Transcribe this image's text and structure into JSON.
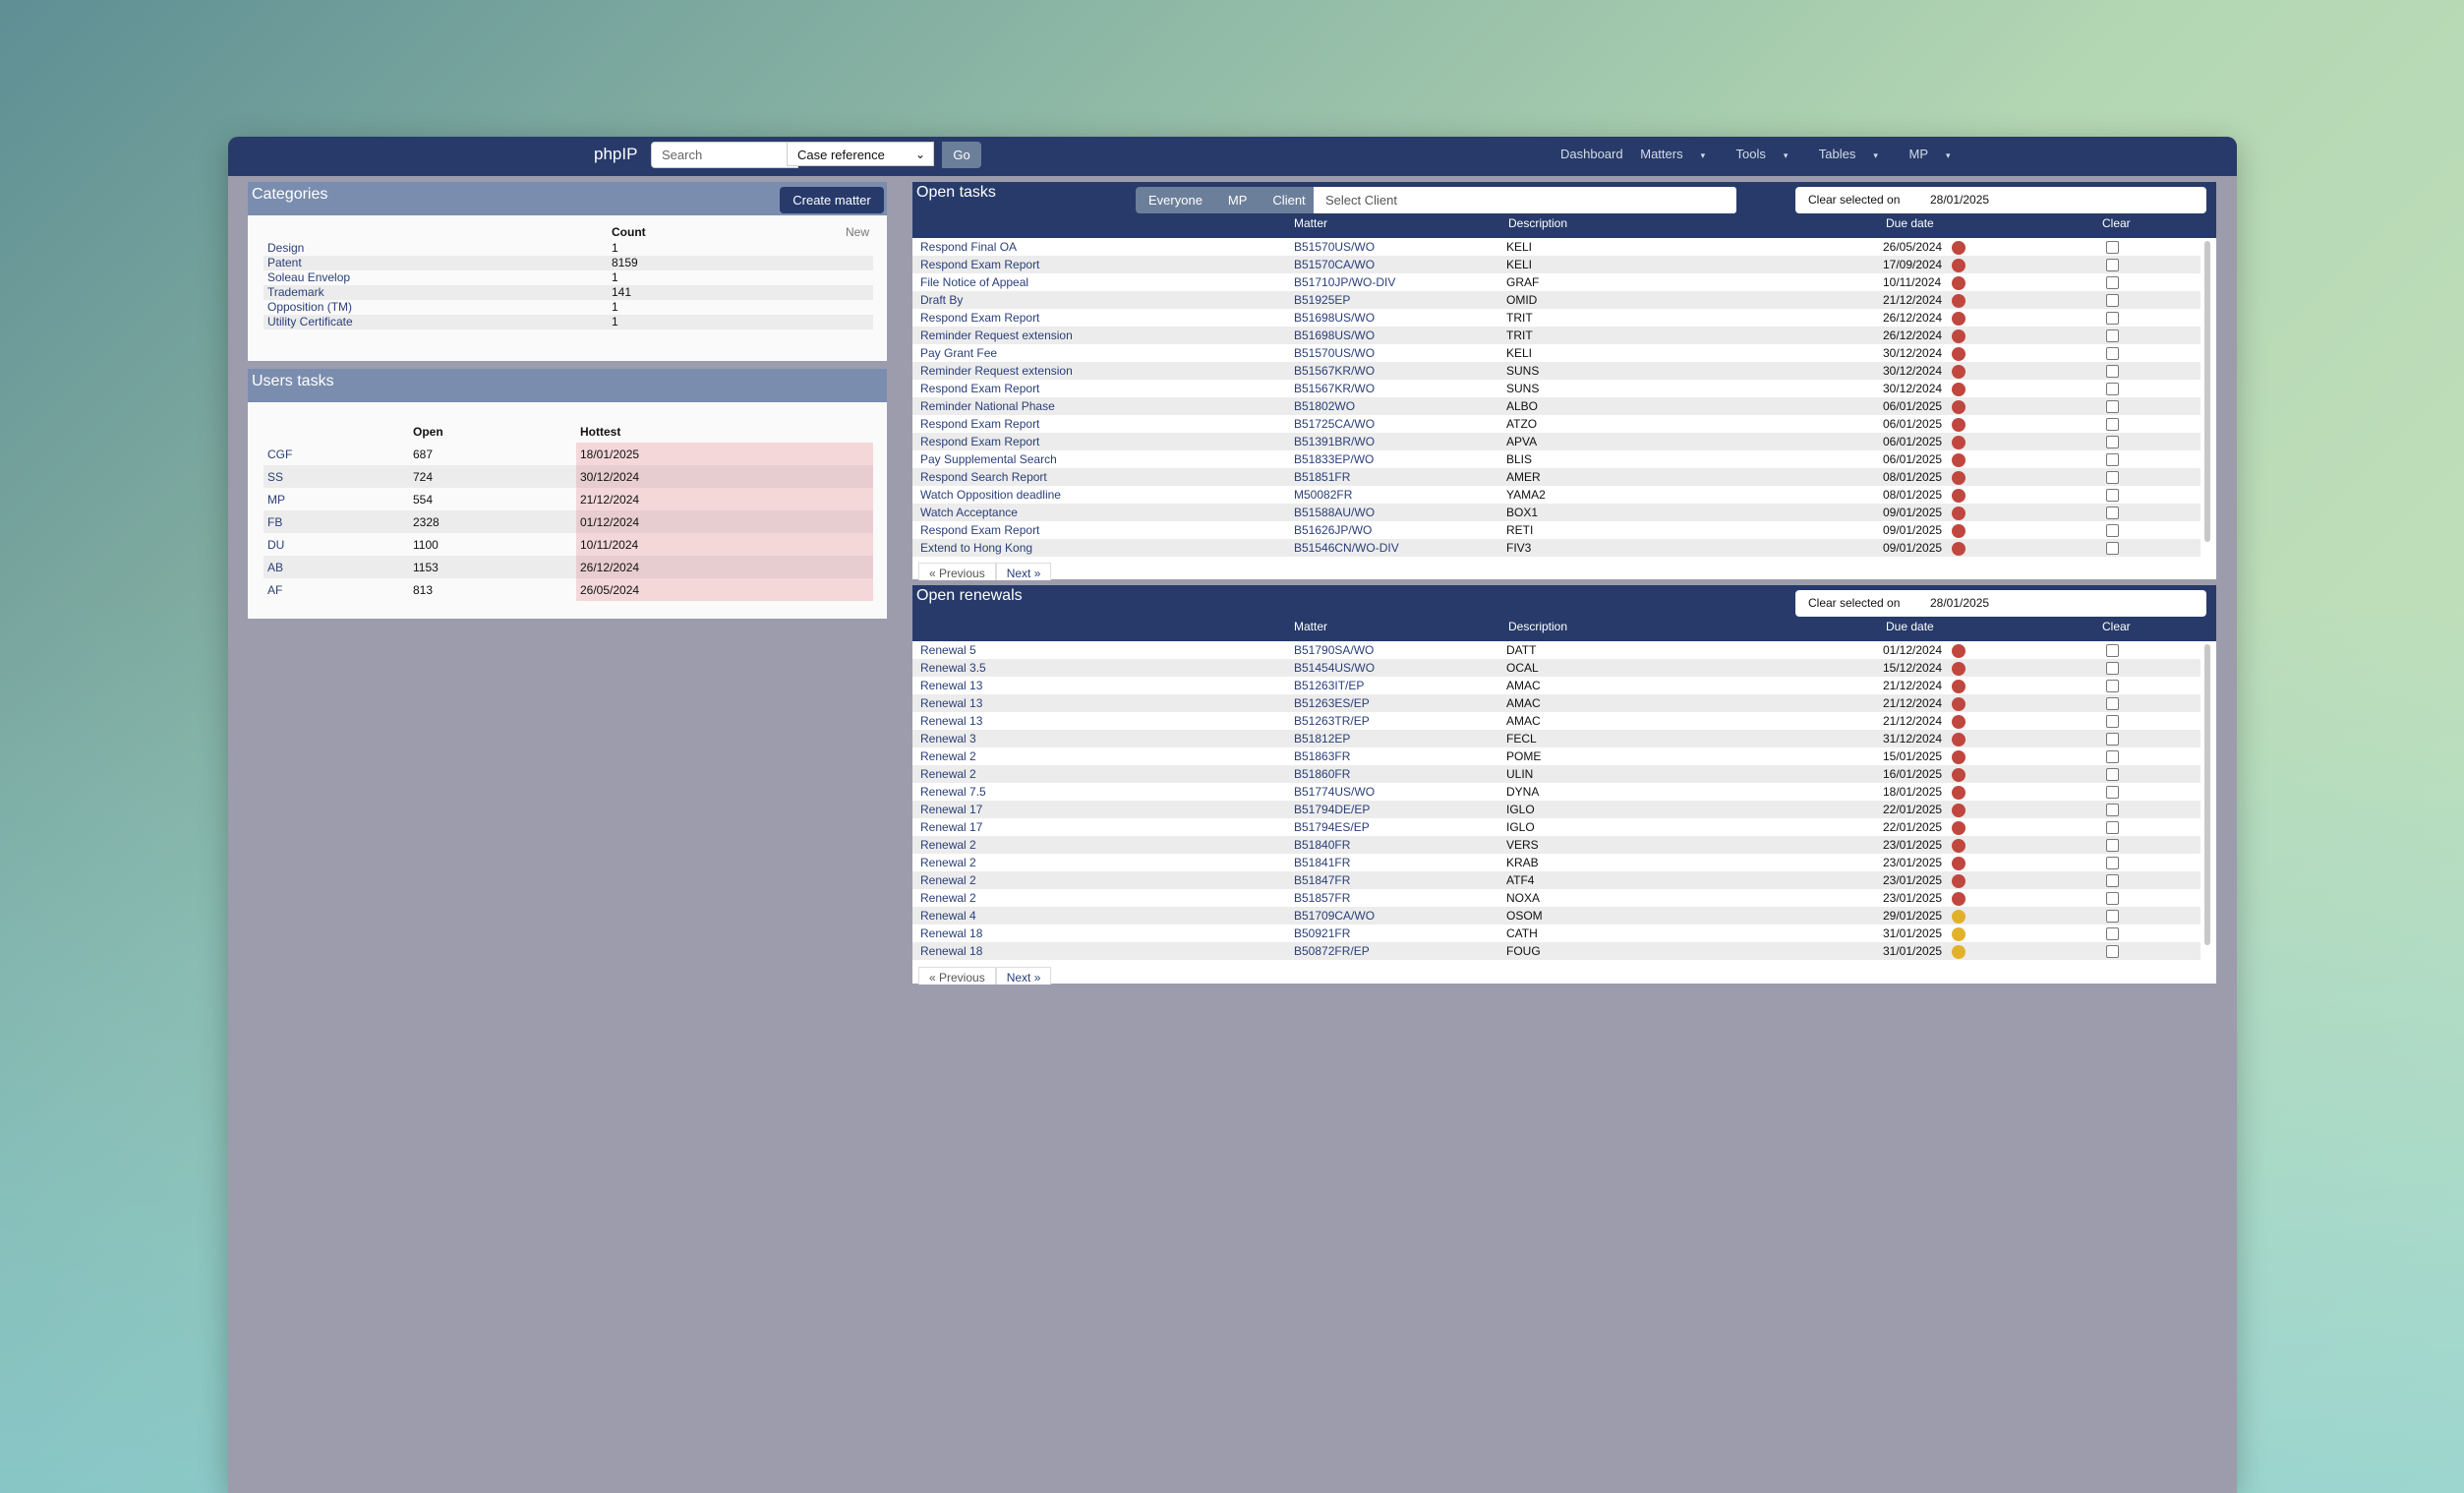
{
  "nav": {
    "brand": "phpIP",
    "search_placeholder": "Search",
    "search_type": "Case reference",
    "go": "Go",
    "menu": [
      "Dashboard",
      "Matters",
      "Tools",
      "Tables",
      "MP"
    ]
  },
  "categories": {
    "title": "Categories",
    "create_button": "Create matter",
    "col_count": "Count",
    "col_new": "New",
    "rows": [
      {
        "name": "Design",
        "count": "1"
      },
      {
        "name": "Patent",
        "count": "8159"
      },
      {
        "name": "Soleau Envelop",
        "count": "1"
      },
      {
        "name": "Trademark",
        "count": "141"
      },
      {
        "name": "Opposition (TM)",
        "count": "1"
      },
      {
        "name": "Utility Certificate",
        "count": "1"
      }
    ]
  },
  "users_tasks": {
    "title": "Users tasks",
    "col_open": "Open",
    "col_hottest": "Hottest",
    "rows": [
      {
        "user": "CGF",
        "open": "687",
        "hottest": "18/01/2025"
      },
      {
        "user": "SS",
        "open": "724",
        "hottest": "30/12/2024"
      },
      {
        "user": "MP",
        "open": "554",
        "hottest": "21/12/2024"
      },
      {
        "user": "FB",
        "open": "2328",
        "hottest": "01/12/2024"
      },
      {
        "user": "DU",
        "open": "1100",
        "hottest": "10/11/2024"
      },
      {
        "user": "AB",
        "open": "1153",
        "hottest": "26/12/2024"
      },
      {
        "user": "AF",
        "open": "813",
        "hottest": "26/05/2024"
      }
    ]
  },
  "open_tasks": {
    "title": "Open tasks",
    "filters": [
      "Everyone",
      "MP",
      "Client"
    ],
    "client_placeholder": "Select Client",
    "clear_label": "Clear selected on",
    "clear_date": "28/01/2025",
    "columns": {
      "matter": "Matter",
      "description": "Description",
      "due": "Due date",
      "clear": "Clear"
    },
    "prev": "« Previous",
    "next": "Next »",
    "rows": [
      {
        "task": "Respond Final OA",
        "matter": "B51570US/WO",
        "desc": "KELI",
        "due": "26/05/2024",
        "status": "red"
      },
      {
        "task": "Respond Exam Report",
        "matter": "B51570CA/WO",
        "desc": "KELI",
        "due": "17/09/2024",
        "status": "red"
      },
      {
        "task": "File Notice of Appeal",
        "matter": "B51710JP/WO-DIV",
        "desc": "GRAF",
        "due": "10/11/2024",
        "status": "red"
      },
      {
        "task": "Draft By",
        "matter": "B51925EP",
        "desc": "OMID",
        "due": "21/12/2024",
        "status": "red"
      },
      {
        "task": "Respond Exam Report",
        "matter": "B51698US/WO",
        "desc": "TRIT",
        "due": "26/12/2024",
        "status": "red"
      },
      {
        "task": "Reminder Request extension",
        "matter": "B51698US/WO",
        "desc": "TRIT",
        "due": "26/12/2024",
        "status": "red"
      },
      {
        "task": "Pay Grant Fee",
        "matter": "B51570US/WO",
        "desc": "KELI",
        "due": "30/12/2024",
        "status": "red"
      },
      {
        "task": "Reminder Request extension",
        "matter": "B51567KR/WO",
        "desc": "SUNS",
        "due": "30/12/2024",
        "status": "red"
      },
      {
        "task": "Respond Exam Report",
        "matter": "B51567KR/WO",
        "desc": "SUNS",
        "due": "30/12/2024",
        "status": "red"
      },
      {
        "task": "Reminder National Phase",
        "matter": "B51802WO",
        "desc": "ALBO",
        "due": "06/01/2025",
        "status": "red"
      },
      {
        "task": "Respond Exam Report",
        "matter": "B51725CA/WO",
        "desc": "ATZO",
        "due": "06/01/2025",
        "status": "red"
      },
      {
        "task": "Respond Exam Report",
        "matter": "B51391BR/WO",
        "desc": "APVA",
        "due": "06/01/2025",
        "status": "red"
      },
      {
        "task": "Pay Supplemental Search",
        "matter": "B51833EP/WO",
        "desc": "BLIS",
        "due": "06/01/2025",
        "status": "red"
      },
      {
        "task": "Respond Search Report",
        "matter": "B51851FR",
        "desc": "AMER",
        "due": "08/01/2025",
        "status": "red"
      },
      {
        "task": "Watch Opposition deadline",
        "matter": "M50082FR",
        "desc": "YAMA2",
        "due": "08/01/2025",
        "status": "red"
      },
      {
        "task": "Watch Acceptance",
        "matter": "B51588AU/WO",
        "desc": "BOX1",
        "due": "09/01/2025",
        "status": "red"
      },
      {
        "task": "Respond Exam Report",
        "matter": "B51626JP/WO",
        "desc": "RETI",
        "due": "09/01/2025",
        "status": "red"
      },
      {
        "task": "Extend to Hong Kong",
        "matter": "B51546CN/WO-DIV",
        "desc": "FIV3",
        "due": "09/01/2025",
        "status": "red"
      }
    ]
  },
  "open_renewals": {
    "title": "Open renewals",
    "clear_label": "Clear selected on",
    "clear_date": "28/01/2025",
    "columns": {
      "matter": "Matter",
      "description": "Description",
      "due": "Due date",
      "clear": "Clear"
    },
    "prev": "« Previous",
    "next": "Next »",
    "rows": [
      {
        "task": "Renewal 5",
        "matter": "B51790SA/WO",
        "desc": "DATT",
        "due": "01/12/2024",
        "status": "red"
      },
      {
        "task": "Renewal 3.5",
        "matter": "B51454US/WO",
        "desc": "OCAL",
        "due": "15/12/2024",
        "status": "red"
      },
      {
        "task": "Renewal 13",
        "matter": "B51263IT/EP",
        "desc": "AMAC",
        "due": "21/12/2024",
        "status": "red"
      },
      {
        "task": "Renewal 13",
        "matter": "B51263ES/EP",
        "desc": "AMAC",
        "due": "21/12/2024",
        "status": "red"
      },
      {
        "task": "Renewal 13",
        "matter": "B51263TR/EP",
        "desc": "AMAC",
        "due": "21/12/2024",
        "status": "red"
      },
      {
        "task": "Renewal 3",
        "matter": "B51812EP",
        "desc": "FECL",
        "due": "31/12/2024",
        "status": "red"
      },
      {
        "task": "Renewal 2",
        "matter": "B51863FR",
        "desc": "POME",
        "due": "15/01/2025",
        "status": "red"
      },
      {
        "task": "Renewal 2",
        "matter": "B51860FR",
        "desc": "ULIN",
        "due": "16/01/2025",
        "status": "red"
      },
      {
        "task": "Renewal 7.5",
        "matter": "B51774US/WO",
        "desc": "DYNA",
        "due": "18/01/2025",
        "status": "red"
      },
      {
        "task": "Renewal 17",
        "matter": "B51794DE/EP",
        "desc": "IGLO",
        "due": "22/01/2025",
        "status": "red"
      },
      {
        "task": "Renewal 17",
        "matter": "B51794ES/EP",
        "desc": "IGLO",
        "due": "22/01/2025",
        "status": "red"
      },
      {
        "task": "Renewal 2",
        "matter": "B51840FR",
        "desc": "VERS",
        "due": "23/01/2025",
        "status": "red"
      },
      {
        "task": "Renewal 2",
        "matter": "B51841FR",
        "desc": "KRAB",
        "due": "23/01/2025",
        "status": "red"
      },
      {
        "task": "Renewal 2",
        "matter": "B51847FR",
        "desc": "ATF4",
        "due": "23/01/2025",
        "status": "red"
      },
      {
        "task": "Renewal 2",
        "matter": "B51857FR",
        "desc": "NOXA",
        "due": "23/01/2025",
        "status": "red"
      },
      {
        "task": "Renewal 4",
        "matter": "B51709CA/WO",
        "desc": "OSOM",
        "due": "29/01/2025",
        "status": "amber"
      },
      {
        "task": "Renewal 18",
        "matter": "B50921FR",
        "desc": "CATH",
        "due": "31/01/2025",
        "status": "amber"
      },
      {
        "task": "Renewal 18",
        "matter": "B50872FR/EP",
        "desc": "FOUG",
        "due": "31/01/2025",
        "status": "amber"
      }
    ]
  },
  "colors": {
    "navbar": "#273a6a",
    "overdue": "#c0473f",
    "soon": "#e2b12c",
    "panel_head": "#7a8dae"
  }
}
